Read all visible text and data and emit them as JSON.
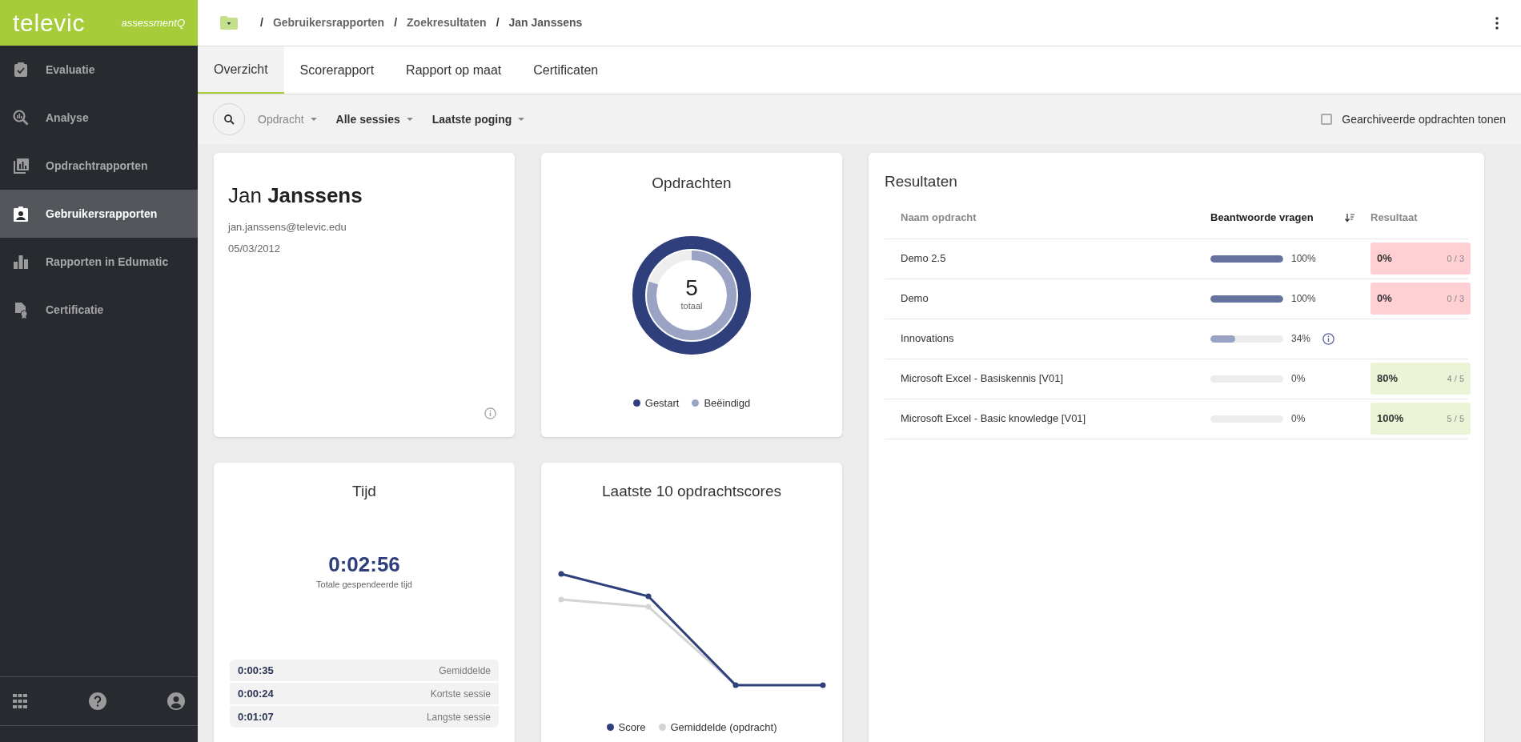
{
  "brand": {
    "logo": "televic",
    "product": "assessmentQ"
  },
  "sidebar": {
    "items": [
      {
        "label": "Evaluatie",
        "selected": false
      },
      {
        "label": "Analyse",
        "selected": false
      },
      {
        "label": "Opdrachtrapporten",
        "selected": false
      },
      {
        "label": "Gebruikersrapporten",
        "selected": true
      },
      {
        "label": "Rapporten in Edumatic",
        "selected": false
      },
      {
        "label": "Certificatie",
        "selected": false
      }
    ]
  },
  "breadcrumb": [
    {
      "separator": "/",
      "label": "Gebruikersrapporten"
    },
    {
      "separator": "/",
      "label": "Zoekresultaten"
    },
    {
      "separator": "/",
      "label": "Jan Janssens"
    }
  ],
  "tabs": [
    {
      "label": "Overzicht",
      "selected": true
    },
    {
      "label": "Scorerapport",
      "selected": false
    },
    {
      "label": "Rapport op maat",
      "selected": false
    },
    {
      "label": "Certificaten",
      "selected": false
    }
  ],
  "filters": [
    {
      "label": "Opdracht",
      "disabled": true
    },
    {
      "label": "Alle sessies",
      "disabled": false
    },
    {
      "label": "Laatste poging",
      "disabled": false
    }
  ],
  "archived_toggle": {
    "label": "Gearchiveerde opdrachten tonen",
    "checked": false
  },
  "profile": {
    "first_name": "Jan",
    "last_name": "Janssens",
    "email": "jan.janssens@televic.edu",
    "date": "05/03/2012"
  },
  "assignments": {
    "title": "Opdrachten",
    "total": "5",
    "total_label": "totaal",
    "legend": [
      {
        "label": "Gestart",
        "color": "#2e3f7c"
      },
      {
        "label": "Beëindigd",
        "color": "#9aa3c4"
      }
    ]
  },
  "time": {
    "title": "Tijd",
    "total": "0:02:56",
    "total_label": "Totale gespendeerde tijd",
    "stats": [
      {
        "value": "0:00:35",
        "label": "Gemiddelde"
      },
      {
        "value": "0:00:24",
        "label": "Kortste sessie"
      },
      {
        "value": "0:01:07",
        "label": "Langste sessie"
      }
    ]
  },
  "scores": {
    "title": "Laatste 10 opdrachtscores",
    "legend": [
      {
        "label": "Score",
        "color": "#2e3f7c"
      },
      {
        "label": "Gemiddelde (opdracht)",
        "color": "#d4d4d4"
      }
    ]
  },
  "results": {
    "title": "Resultaten",
    "columns": [
      {
        "label": "Naam opdracht",
        "sorted": false
      },
      {
        "label": "Beantwoorde vragen",
        "sorted": true
      },
      {
        "label": "Resultaat",
        "sorted": false
      }
    ],
    "rows": [
      {
        "name": "Demo 2.5",
        "level": 1,
        "percent": "100%",
        "info": false,
        "result": {
          "percent": "0%",
          "score": "0 / 3",
          "color": "#ffd0d3"
        }
      },
      {
        "name": "Demo",
        "level": 1,
        "percent": "100%",
        "info": false,
        "result": {
          "percent": "0%",
          "score": "0 / 3",
          "color": "#ffd0d3"
        }
      },
      {
        "name": "Innovations",
        "level": 0.34,
        "percent": "34%",
        "info": true
      },
      {
        "name": "Microsoft Excel - Basiskennis [V01]",
        "level": 0,
        "percent": "0%",
        "info": false,
        "result": {
          "percent": "80%",
          "score": "4 / 5",
          "color": "#ebf4d7"
        }
      },
      {
        "name": "Microsoft Excel - Basic knowledge [V01]",
        "level": 0,
        "percent": "0%",
        "info": false,
        "result": {
          "percent": "100%",
          "score": "5 / 5",
          "color": "#ebf4d7"
        }
      }
    ]
  }
}
